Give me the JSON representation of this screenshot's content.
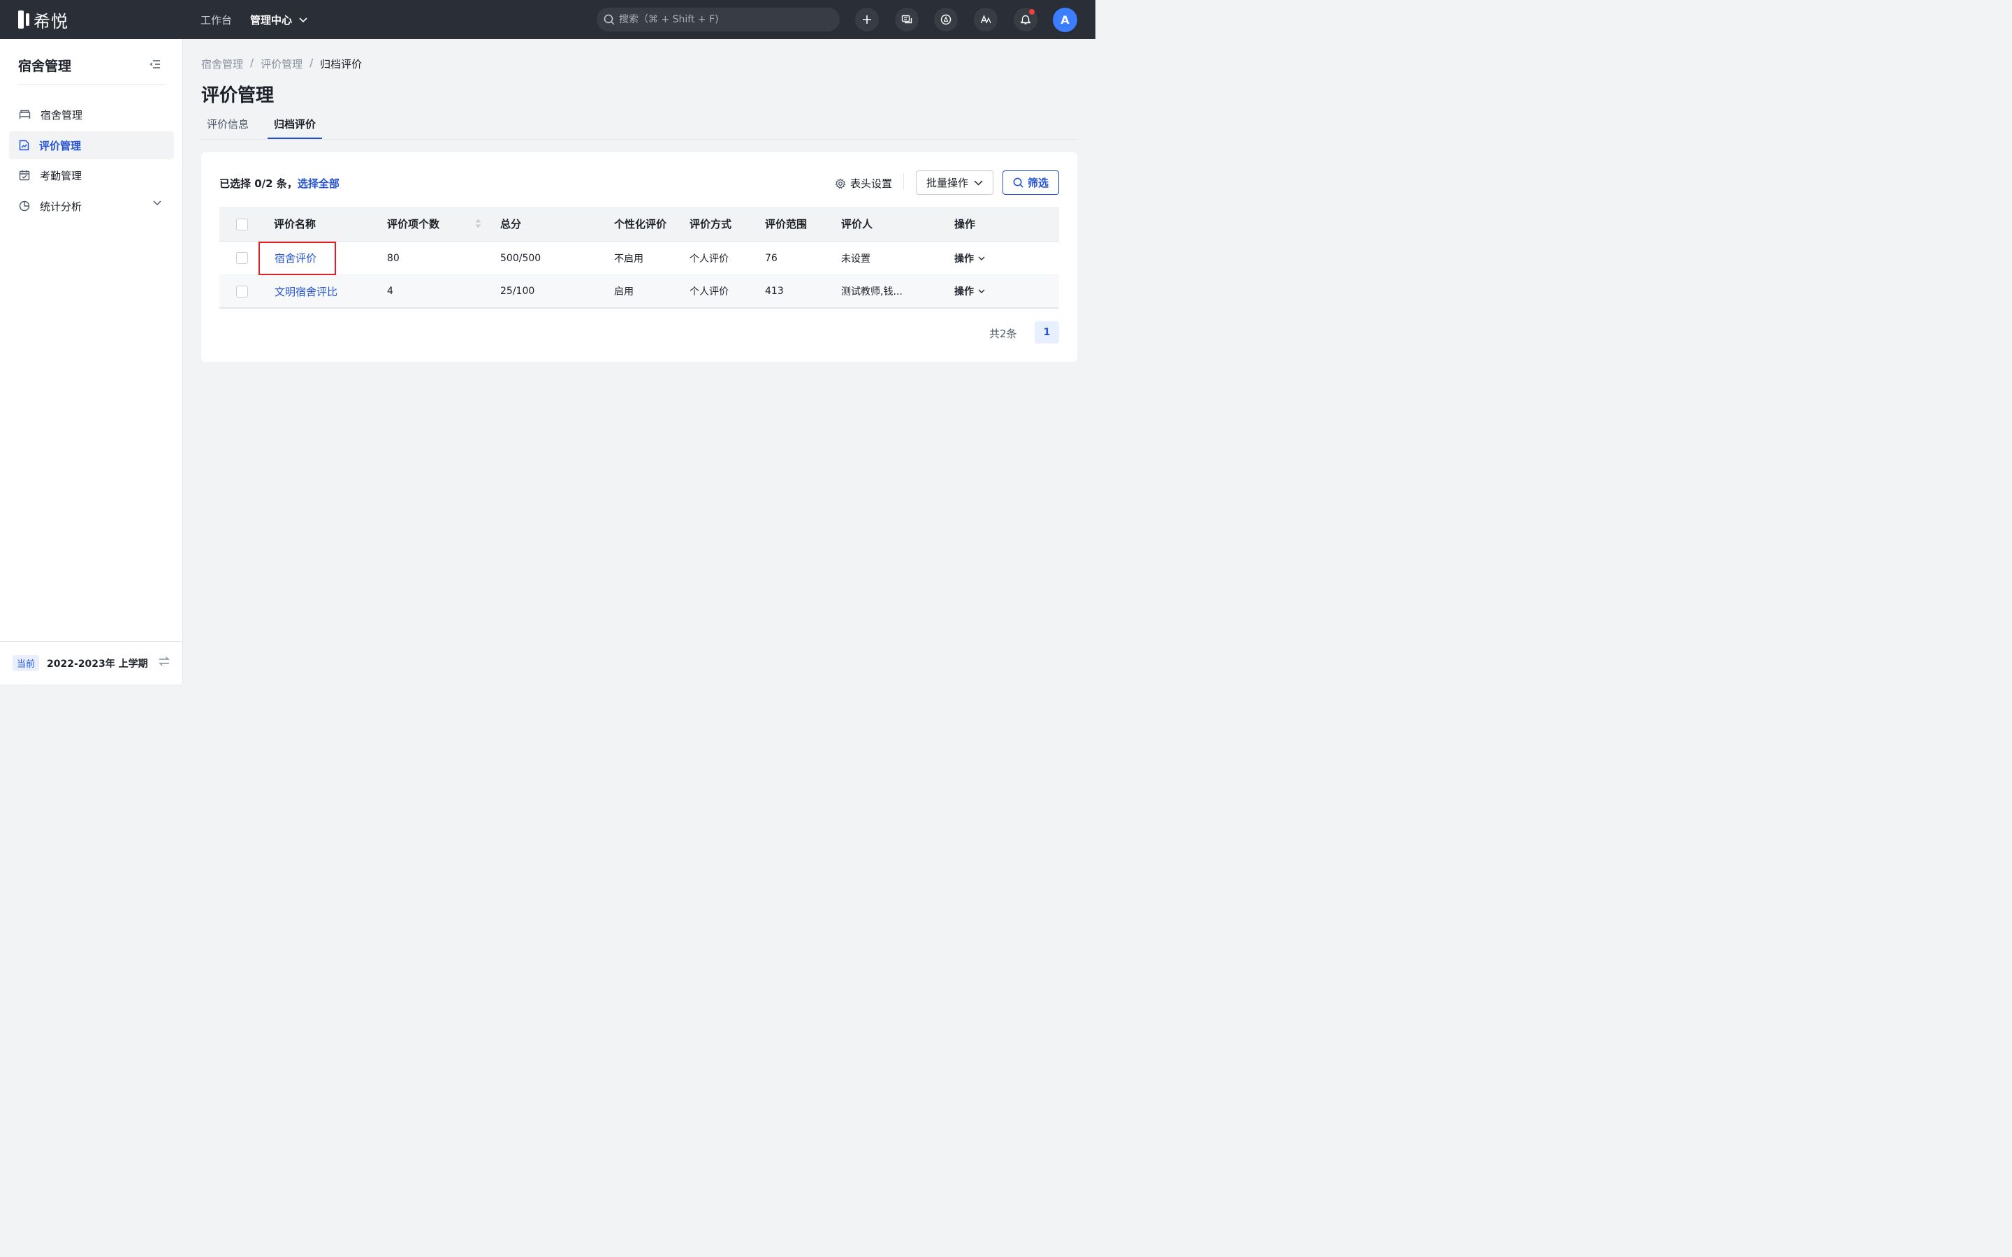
{
  "topbar": {
    "logo_text": "希悦",
    "nav": [
      {
        "label": "工作台"
      },
      {
        "label": "管理中心"
      }
    ],
    "search_placeholder": "搜索（⌘ + Shift + F)",
    "avatar_letter": "A",
    "icons": [
      "plus-icon",
      "message-icon",
      "compass-icon",
      "font-icon",
      "bell-icon"
    ]
  },
  "sidebar": {
    "title": "宿舍管理",
    "items": [
      {
        "label": "宿舍管理",
        "icon": "bed-icon"
      },
      {
        "label": "评价管理",
        "icon": "chart-doc-icon"
      },
      {
        "label": "考勤管理",
        "icon": "calendar-icon"
      },
      {
        "label": "统计分析",
        "icon": "pie-chart-icon"
      }
    ],
    "term_badge": "当前",
    "term_text": "2022-2023年 上学期"
  },
  "breadcrumb": [
    "宿舍管理",
    "/",
    "评价管理",
    "/",
    "归档评价"
  ],
  "page_title": "评价管理",
  "tabs": [
    {
      "label": "评价信息"
    },
    {
      "label": "归档评价"
    }
  ],
  "toolbar": {
    "selected_prefix": "已选择 0/2 条，",
    "select_all": "选择全部",
    "column_settings": "表头设置",
    "batch": "批量操作",
    "filter": "筛选"
  },
  "table": {
    "headers": [
      "评价名称",
      "评价项个数",
      "总分",
      "个性化评价",
      "评价方式",
      "评价范围",
      "评价人",
      "操作"
    ],
    "rows": [
      {
        "name": "宿舍评价",
        "items": "80",
        "total": "500/500",
        "personal": "不启用",
        "method": "个人评价",
        "scope": "76",
        "evaluator": "未设置",
        "op": "操作"
      },
      {
        "name": "文明宿舍评比",
        "items": "4",
        "total": "25/100",
        "personal": "启用",
        "method": "个人评价",
        "scope": "413",
        "evaluator": "测试教师,钱...",
        "op": "操作"
      }
    ]
  },
  "pagination": {
    "total": "共2条",
    "current": "1"
  },
  "colors": {
    "topbar": "#2a2e36",
    "primary": "#2553d6",
    "highlight": "#e02020"
  }
}
